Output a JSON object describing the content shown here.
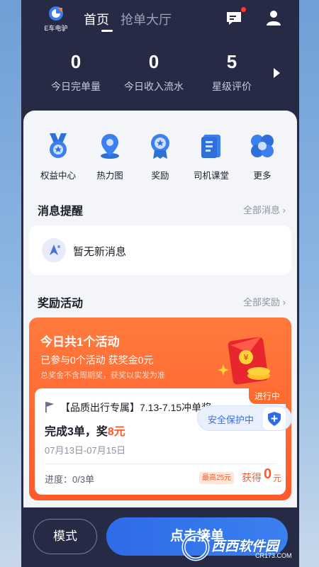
{
  "header": {
    "logo_text": "E车电驴",
    "tabs": [
      {
        "label": "首页",
        "active": true
      },
      {
        "label": "抢单大厅",
        "active": false
      }
    ],
    "icons": [
      "message-icon",
      "user-icon"
    ]
  },
  "stats": [
    {
      "value": "0",
      "label": "今日完单量"
    },
    {
      "value": "0",
      "label": "今日收入流水"
    },
    {
      "value": "5",
      "label": "星级评价"
    }
  ],
  "grid": [
    {
      "label": "权益中心",
      "icon": "medal-icon"
    },
    {
      "label": "热力图",
      "icon": "location-pin-icon"
    },
    {
      "label": "奖励",
      "icon": "award-icon"
    },
    {
      "label": "司机课堂",
      "icon": "book-icon"
    },
    {
      "label": "更多",
      "icon": "more-icon"
    }
  ],
  "messages": {
    "title": "消息提醒",
    "more": "全部消息",
    "empty_text": "暂无新消息"
  },
  "rewards": {
    "title": "奖励活动",
    "more": "全部奖励",
    "card_title": "今日共1个活动",
    "card_sub": "已参与0个活动 获奖金0元",
    "card_note": "总奖金不含周期奖，获奖以实发为准",
    "status": "进行中",
    "activity_title": "【品质出行专属】7.13-7.15冲单奖",
    "task_prefix": "完成3单，奖",
    "task_reward": "8元",
    "date_range": "07月13日-07月15日",
    "progress": "进度：0/3单",
    "max_badge": "最高25元",
    "earn_label": "获得",
    "earn_amount": "0",
    "earn_unit": "元"
  },
  "safety": {
    "label": "安全保护中"
  },
  "bottom": {
    "mode_label": "模式",
    "accept_label": "点击接单"
  },
  "watermark": {
    "text": "西西软件园",
    "sub": "CR173.COM"
  },
  "colors": {
    "dark_bg": "#262a45",
    "accent_orange": "#ff5a2a",
    "accent_blue": "#2e6be8"
  }
}
